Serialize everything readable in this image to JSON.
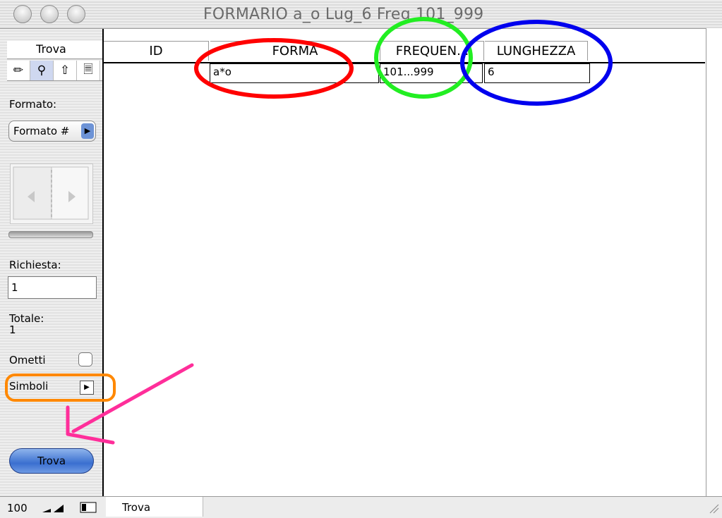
{
  "window": {
    "title": "FORMARIO a_o Lug_6 Freq 101_999"
  },
  "toolbar_panel": {
    "mode_label": "Trova",
    "format_label": "Formato:",
    "format_value": "Formato #",
    "request_label": "Richiesta:",
    "request_value": "1",
    "total_label": "Totale:",
    "total_value": "1",
    "omit_label": "Ometti",
    "symbols_label": "Simboli",
    "find_button": "Trova"
  },
  "table": {
    "columns": [
      "ID",
      "FORMA",
      "FREQUEN...",
      "LUNGHEZZA"
    ],
    "row": {
      "id": "",
      "forma": "a*o",
      "frequenza": "101...999",
      "lunghezza": "6"
    }
  },
  "status_bar": {
    "zoom": "100",
    "mode": "Trova"
  },
  "annotation_colors": {
    "forma": "#ff0000",
    "frequenza": "#22ee22",
    "lunghezza": "#0000ee",
    "simboli": "#ff8800",
    "arrow": "#ff2e9a"
  }
}
